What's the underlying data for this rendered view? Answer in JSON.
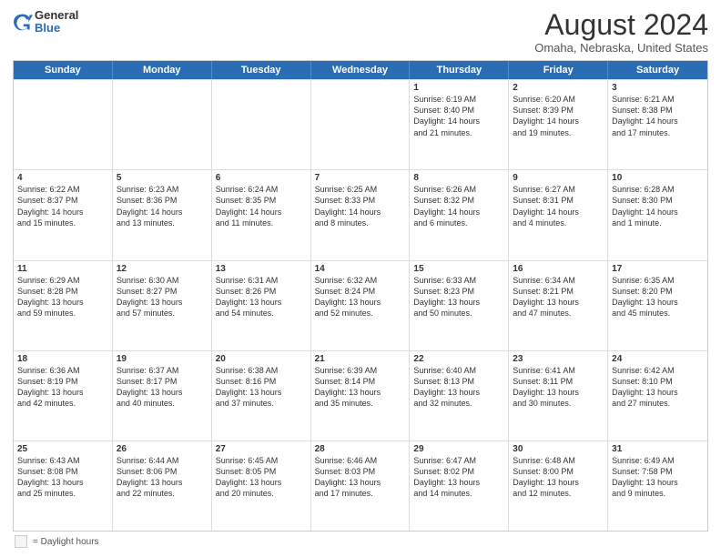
{
  "logo": {
    "general": "General",
    "blue": "Blue"
  },
  "title": "August 2024",
  "subtitle": "Omaha, Nebraska, United States",
  "weekdays": [
    "Sunday",
    "Monday",
    "Tuesday",
    "Wednesday",
    "Thursday",
    "Friday",
    "Saturday"
  ],
  "weeks": [
    [
      {
        "day": "",
        "lines": []
      },
      {
        "day": "",
        "lines": []
      },
      {
        "day": "",
        "lines": []
      },
      {
        "day": "",
        "lines": []
      },
      {
        "day": "1",
        "lines": [
          "Sunrise: 6:19 AM",
          "Sunset: 8:40 PM",
          "Daylight: 14 hours",
          "and 21 minutes."
        ]
      },
      {
        "day": "2",
        "lines": [
          "Sunrise: 6:20 AM",
          "Sunset: 8:39 PM",
          "Daylight: 14 hours",
          "and 19 minutes."
        ]
      },
      {
        "day": "3",
        "lines": [
          "Sunrise: 6:21 AM",
          "Sunset: 8:38 PM",
          "Daylight: 14 hours",
          "and 17 minutes."
        ]
      }
    ],
    [
      {
        "day": "4",
        "lines": [
          "Sunrise: 6:22 AM",
          "Sunset: 8:37 PM",
          "Daylight: 14 hours",
          "and 15 minutes."
        ]
      },
      {
        "day": "5",
        "lines": [
          "Sunrise: 6:23 AM",
          "Sunset: 8:36 PM",
          "Daylight: 14 hours",
          "and 13 minutes."
        ]
      },
      {
        "day": "6",
        "lines": [
          "Sunrise: 6:24 AM",
          "Sunset: 8:35 PM",
          "Daylight: 14 hours",
          "and 11 minutes."
        ]
      },
      {
        "day": "7",
        "lines": [
          "Sunrise: 6:25 AM",
          "Sunset: 8:33 PM",
          "Daylight: 14 hours",
          "and 8 minutes."
        ]
      },
      {
        "day": "8",
        "lines": [
          "Sunrise: 6:26 AM",
          "Sunset: 8:32 PM",
          "Daylight: 14 hours",
          "and 6 minutes."
        ]
      },
      {
        "day": "9",
        "lines": [
          "Sunrise: 6:27 AM",
          "Sunset: 8:31 PM",
          "Daylight: 14 hours",
          "and 4 minutes."
        ]
      },
      {
        "day": "10",
        "lines": [
          "Sunrise: 6:28 AM",
          "Sunset: 8:30 PM",
          "Daylight: 14 hours",
          "and 1 minute."
        ]
      }
    ],
    [
      {
        "day": "11",
        "lines": [
          "Sunrise: 6:29 AM",
          "Sunset: 8:28 PM",
          "Daylight: 13 hours",
          "and 59 minutes."
        ]
      },
      {
        "day": "12",
        "lines": [
          "Sunrise: 6:30 AM",
          "Sunset: 8:27 PM",
          "Daylight: 13 hours",
          "and 57 minutes."
        ]
      },
      {
        "day": "13",
        "lines": [
          "Sunrise: 6:31 AM",
          "Sunset: 8:26 PM",
          "Daylight: 13 hours",
          "and 54 minutes."
        ]
      },
      {
        "day": "14",
        "lines": [
          "Sunrise: 6:32 AM",
          "Sunset: 8:24 PM",
          "Daylight: 13 hours",
          "and 52 minutes."
        ]
      },
      {
        "day": "15",
        "lines": [
          "Sunrise: 6:33 AM",
          "Sunset: 8:23 PM",
          "Daylight: 13 hours",
          "and 50 minutes."
        ]
      },
      {
        "day": "16",
        "lines": [
          "Sunrise: 6:34 AM",
          "Sunset: 8:21 PM",
          "Daylight: 13 hours",
          "and 47 minutes."
        ]
      },
      {
        "day": "17",
        "lines": [
          "Sunrise: 6:35 AM",
          "Sunset: 8:20 PM",
          "Daylight: 13 hours",
          "and 45 minutes."
        ]
      }
    ],
    [
      {
        "day": "18",
        "lines": [
          "Sunrise: 6:36 AM",
          "Sunset: 8:19 PM",
          "Daylight: 13 hours",
          "and 42 minutes."
        ]
      },
      {
        "day": "19",
        "lines": [
          "Sunrise: 6:37 AM",
          "Sunset: 8:17 PM",
          "Daylight: 13 hours",
          "and 40 minutes."
        ]
      },
      {
        "day": "20",
        "lines": [
          "Sunrise: 6:38 AM",
          "Sunset: 8:16 PM",
          "Daylight: 13 hours",
          "and 37 minutes."
        ]
      },
      {
        "day": "21",
        "lines": [
          "Sunrise: 6:39 AM",
          "Sunset: 8:14 PM",
          "Daylight: 13 hours",
          "and 35 minutes."
        ]
      },
      {
        "day": "22",
        "lines": [
          "Sunrise: 6:40 AM",
          "Sunset: 8:13 PM",
          "Daylight: 13 hours",
          "and 32 minutes."
        ]
      },
      {
        "day": "23",
        "lines": [
          "Sunrise: 6:41 AM",
          "Sunset: 8:11 PM",
          "Daylight: 13 hours",
          "and 30 minutes."
        ]
      },
      {
        "day": "24",
        "lines": [
          "Sunrise: 6:42 AM",
          "Sunset: 8:10 PM",
          "Daylight: 13 hours",
          "and 27 minutes."
        ]
      }
    ],
    [
      {
        "day": "25",
        "lines": [
          "Sunrise: 6:43 AM",
          "Sunset: 8:08 PM",
          "Daylight: 13 hours",
          "and 25 minutes."
        ]
      },
      {
        "day": "26",
        "lines": [
          "Sunrise: 6:44 AM",
          "Sunset: 8:06 PM",
          "Daylight: 13 hours",
          "and 22 minutes."
        ]
      },
      {
        "day": "27",
        "lines": [
          "Sunrise: 6:45 AM",
          "Sunset: 8:05 PM",
          "Daylight: 13 hours",
          "and 20 minutes."
        ]
      },
      {
        "day": "28",
        "lines": [
          "Sunrise: 6:46 AM",
          "Sunset: 8:03 PM",
          "Daylight: 13 hours",
          "and 17 minutes."
        ]
      },
      {
        "day": "29",
        "lines": [
          "Sunrise: 6:47 AM",
          "Sunset: 8:02 PM",
          "Daylight: 13 hours",
          "and 14 minutes."
        ]
      },
      {
        "day": "30",
        "lines": [
          "Sunrise: 6:48 AM",
          "Sunset: 8:00 PM",
          "Daylight: 13 hours",
          "and 12 minutes."
        ]
      },
      {
        "day": "31",
        "lines": [
          "Sunrise: 6:49 AM",
          "Sunset: 7:58 PM",
          "Daylight: 13 hours",
          "and 9 minutes."
        ]
      }
    ]
  ],
  "legend": {
    "box_label": "= Daylight hours"
  }
}
